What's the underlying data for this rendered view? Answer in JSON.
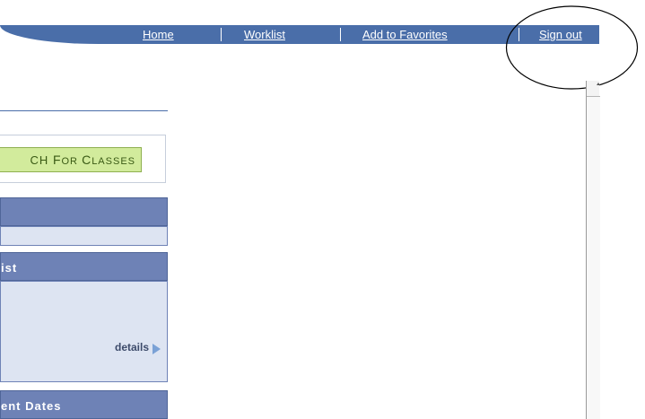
{
  "topnav": {
    "items": [
      {
        "label": "Home"
      },
      {
        "label": "Worklist"
      },
      {
        "label": "Add to Favorites"
      },
      {
        "label": "Sign out"
      }
    ]
  },
  "search": {
    "button_label_part1": "CH ",
    "button_label_part2_big": "F",
    "button_label_part2_small": "OR ",
    "button_label_part3_big": "C",
    "button_label_part3_small": "LASSES"
  },
  "panels": [
    {
      "title": ""
    },
    {
      "title": "ist",
      "details_label": "details"
    },
    {
      "title": "ent Dates"
    }
  ],
  "colors": {
    "nav_bar": "#4a6ea9",
    "panel_header": "#6e82b6",
    "panel_body": "#dde4f2",
    "search_button": "#d2eb9c"
  },
  "icons": {
    "details_arrow": "triangle-right-icon",
    "scroll_up": "scroll-up-arrow-icon"
  }
}
